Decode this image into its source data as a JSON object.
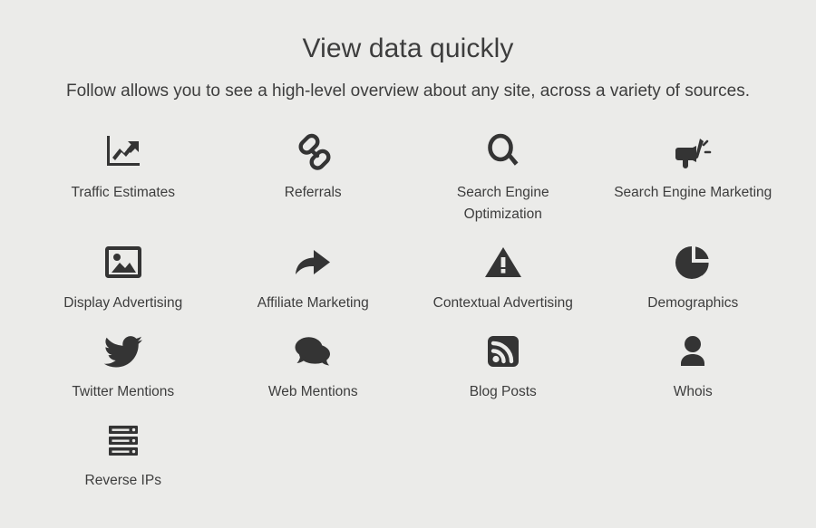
{
  "header": {
    "title": "View data quickly",
    "subtitle": "Follow allows you to see a high-level overview about any site, across a variety of sources."
  },
  "colors": {
    "background": "#ebebe9",
    "text": "#3d3d3d",
    "icon": "#343434"
  },
  "features": [
    {
      "label": "Traffic Estimates",
      "icon": "line-chart-up-icon"
    },
    {
      "label": "Referrals",
      "icon": "chain-link-icon"
    },
    {
      "label": "Search Engine Optimization",
      "icon": "magnifying-glass-icon"
    },
    {
      "label": "Search Engine Marketing",
      "icon": "megaphone-icon"
    },
    {
      "label": "Display Advertising",
      "icon": "picture-icon"
    },
    {
      "label": "Affiliate Marketing",
      "icon": "share-arrow-icon"
    },
    {
      "label": "Contextual Advertising",
      "icon": "warning-triangle-icon"
    },
    {
      "label": "Demographics",
      "icon": "pie-chart-icon"
    },
    {
      "label": "Twitter Mentions",
      "icon": "twitter-bird-icon"
    },
    {
      "label": "Web Mentions",
      "icon": "speech-bubbles-icon"
    },
    {
      "label": "Blog Posts",
      "icon": "rss-feed-icon"
    },
    {
      "label": "Whois",
      "icon": "user-person-icon"
    },
    {
      "label": "Reverse IPs",
      "icon": "server-rack-icon"
    }
  ]
}
